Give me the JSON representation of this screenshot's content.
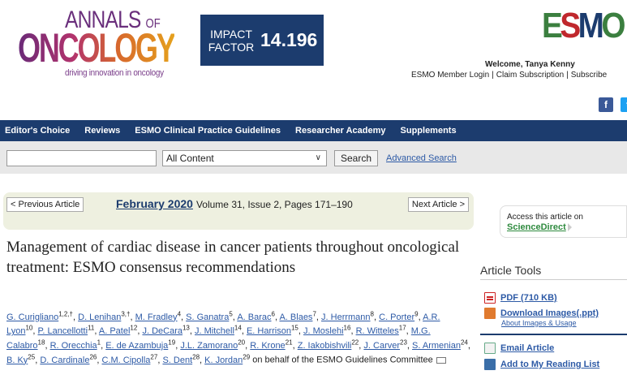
{
  "header": {
    "logo": {
      "line1": "ANNALS",
      "line1_of": "OF",
      "line2": "ONCOLOGY",
      "tagline": "driving innovation in oncology"
    },
    "impact": {
      "label": "IMPACT FACTOR",
      "value": "14.196"
    },
    "esmo_logo": "ESMO",
    "welcome": "Welcome, Tanya Kenny",
    "links": [
      "ESMO Member Login",
      "Claim Subscription",
      "Subscribe"
    ],
    "social": [
      "f",
      "t"
    ]
  },
  "nav": {
    "items": [
      "Editor's Choice",
      "Reviews",
      "ESMO Clinical Practice Guidelines",
      "Researcher Academy",
      "Supplements"
    ]
  },
  "search": {
    "input_value": "",
    "select_value": "All Content",
    "button": "Search",
    "advanced": "Advanced Search"
  },
  "article_nav": {
    "prev": "< Previous Article",
    "next": "Next Article >",
    "issue_month": "February 2020",
    "issue_details": "Volume 31, Issue 2, Pages 171–190"
  },
  "article": {
    "title": "Management of cardiac disease in cancer patients throughout oncological treatment: ESMO consensus recommendations",
    "on_behalf": "on behalf of the ESMO Guidelines Committee",
    "authors": [
      {
        "name": "G. Curigliano",
        "sup": "1,2,†"
      },
      {
        "name": "D. Lenihan",
        "sup": "3,†"
      },
      {
        "name": "M. Fradley",
        "sup": "4"
      },
      {
        "name": "S. Ganatra",
        "sup": "5"
      },
      {
        "name": "A. Barac",
        "sup": "6"
      },
      {
        "name": "A. Blaes",
        "sup": "7"
      },
      {
        "name": "J. Herrmann",
        "sup": "8"
      },
      {
        "name": "C. Porter",
        "sup": "9"
      },
      {
        "name": "A.R. Lyon",
        "sup": "10"
      },
      {
        "name": "P. Lancellotti",
        "sup": "11"
      },
      {
        "name": "A. Patel",
        "sup": "12"
      },
      {
        "name": "J. DeCara",
        "sup": "13"
      },
      {
        "name": "J. Mitchell",
        "sup": "14"
      },
      {
        "name": "E. Harrison",
        "sup": "15"
      },
      {
        "name": "J. Moslehi",
        "sup": "16"
      },
      {
        "name": "R. Witteles",
        "sup": "17"
      },
      {
        "name": "M.G. Calabro",
        "sup": "18"
      },
      {
        "name": "R. Orecchia",
        "sup": "1"
      },
      {
        "name": "E. de Azambuja",
        "sup": "19"
      },
      {
        "name": "J.L. Zamorano",
        "sup": "20"
      },
      {
        "name": "R. Krone",
        "sup": "21"
      },
      {
        "name": "Z. Iakobishvili",
        "sup": "22"
      },
      {
        "name": "J. Carver",
        "sup": "23"
      },
      {
        "name": "S. Armenian",
        "sup": "24"
      },
      {
        "name": "B. Ky",
        "sup": "25"
      },
      {
        "name": "D. Cardinale",
        "sup": "26"
      },
      {
        "name": "C.M. Cipolla",
        "sup": "27"
      },
      {
        "name": "S. Dent",
        "sup": "28"
      },
      {
        "name": "K. Jordan",
        "sup": "29"
      }
    ]
  },
  "sidebar": {
    "access_label": "Access this article on",
    "access_link": "ScienceDirect",
    "tools_title": "Article Tools",
    "tools": [
      {
        "label": "PDF (710 KB)",
        "icon": "pdf-icon"
      },
      {
        "label": "Download Images(.ppt)",
        "icon": "ppt-icon"
      },
      {
        "label": "Email Article",
        "icon": "email-icon"
      },
      {
        "label": "Add to My Reading List",
        "icon": "reading-list-icon"
      }
    ],
    "images_usage": "About Images & Usage"
  },
  "colors": {
    "navy": "#1c3c6e",
    "link": "#2d5aa6",
    "sciencedirect_green": "#2e8a3e",
    "nav_panel": "#eef0e0"
  }
}
